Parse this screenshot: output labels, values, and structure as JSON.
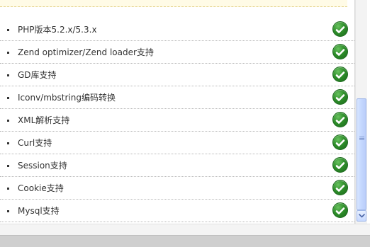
{
  "requirements": [
    {
      "label": "PHP版本5.2.x/5.3.x",
      "status": "ok"
    },
    {
      "label": "Zend optimizer/Zend loader支持",
      "status": "ok"
    },
    {
      "label": "GD库支持",
      "status": "ok"
    },
    {
      "label": "Iconv/mbstring编码转换",
      "status": "ok"
    },
    {
      "label": "XML解析支持",
      "status": "ok"
    },
    {
      "label": "Curl支持",
      "status": "ok"
    },
    {
      "label": "Session支持",
      "status": "ok"
    },
    {
      "label": "Cookie支持",
      "status": "ok"
    },
    {
      "label": "Mysql支持",
      "status": "ok"
    }
  ],
  "icons": {
    "status": "check-circle-icon",
    "scroll_down": "chevron-down-icon"
  },
  "colors": {
    "ok": "#2e8e2a",
    "notice_bg": "#fffbe6",
    "scroll_thumb": "#c6d9ff"
  }
}
